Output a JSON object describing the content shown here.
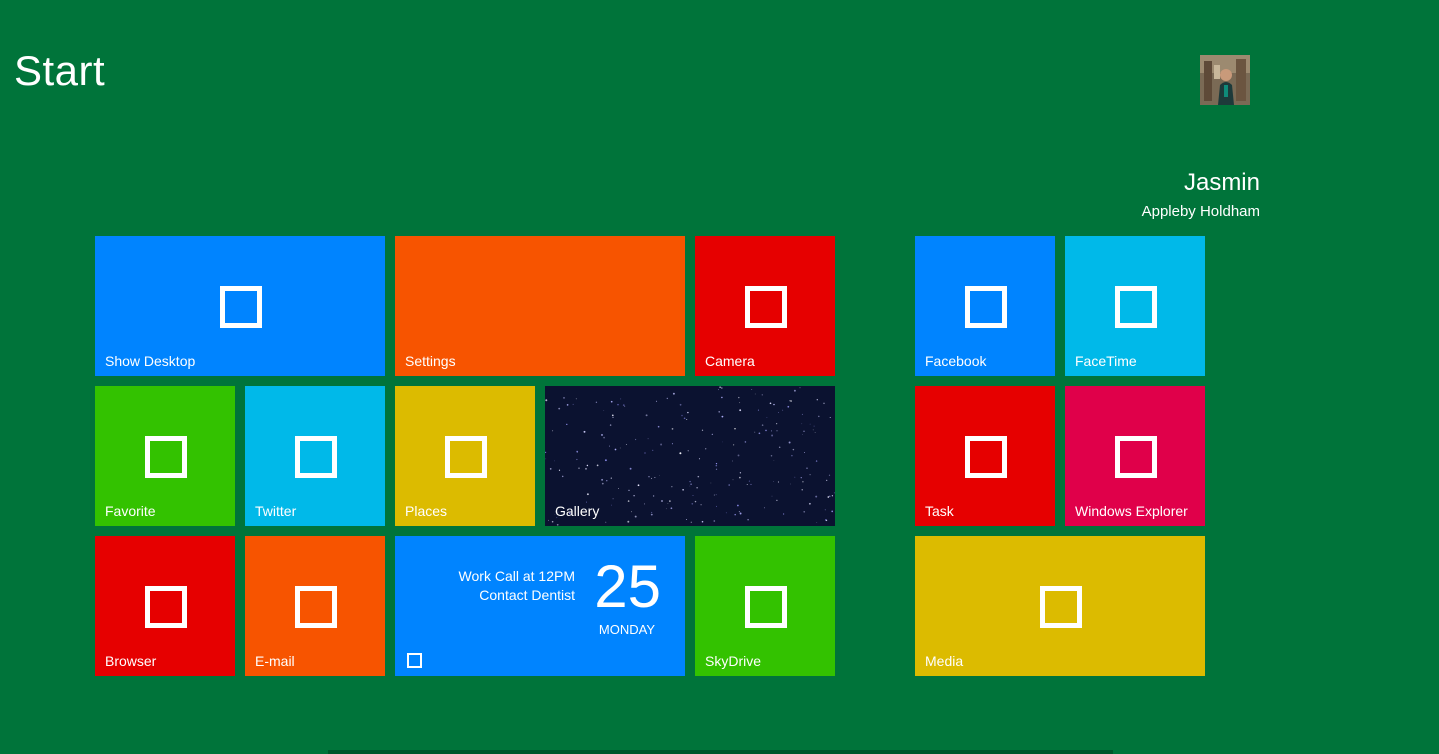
{
  "header": {
    "title": "Start"
  },
  "user": {
    "name": "Jasmin",
    "organization": "Appleby Holdham"
  },
  "colors": {
    "background": "#00743a",
    "blue": "#0084ff",
    "orange": "#f75400",
    "red": "#e60000",
    "green": "#33c200",
    "cyan": "#00b9e9",
    "yellow": "#dcbb00",
    "crimson": "#e0004a",
    "night": "#0b1230"
  },
  "tiles": {
    "show_desktop": {
      "label": "Show Desktop",
      "icon": "square-outline-icon"
    },
    "settings": {
      "label": "Settings"
    },
    "camera": {
      "label": "Camera",
      "icon": "square-outline-icon"
    },
    "favorite": {
      "label": "Favorite",
      "icon": "square-outline-icon"
    },
    "twitter": {
      "label": "Twitter",
      "icon": "square-outline-icon"
    },
    "places": {
      "label": "Places",
      "icon": "square-outline-icon"
    },
    "gallery": {
      "label": "Gallery"
    },
    "browser": {
      "label": "Browser",
      "icon": "square-outline-icon"
    },
    "email": {
      "label": "E-mail",
      "icon": "square-outline-icon"
    },
    "calendar": {
      "event_1": "Work Call at 12PM",
      "event_2": "Contact Dentist",
      "date": "25",
      "day": "MONDAY",
      "icon": "small-square-icon"
    },
    "skydrive": {
      "label": "SkyDrive",
      "icon": "square-outline-icon"
    },
    "facebook": {
      "label": "Facebook",
      "icon": "square-outline-icon"
    },
    "facetime": {
      "label": "FaceTime",
      "icon": "square-outline-icon"
    },
    "task": {
      "label": "Task",
      "icon": "square-outline-icon"
    },
    "windows_explorer": {
      "label": "Windows Explorer",
      "icon": "square-outline-icon"
    },
    "media": {
      "label": "Media",
      "icon": "square-outline-icon"
    }
  }
}
